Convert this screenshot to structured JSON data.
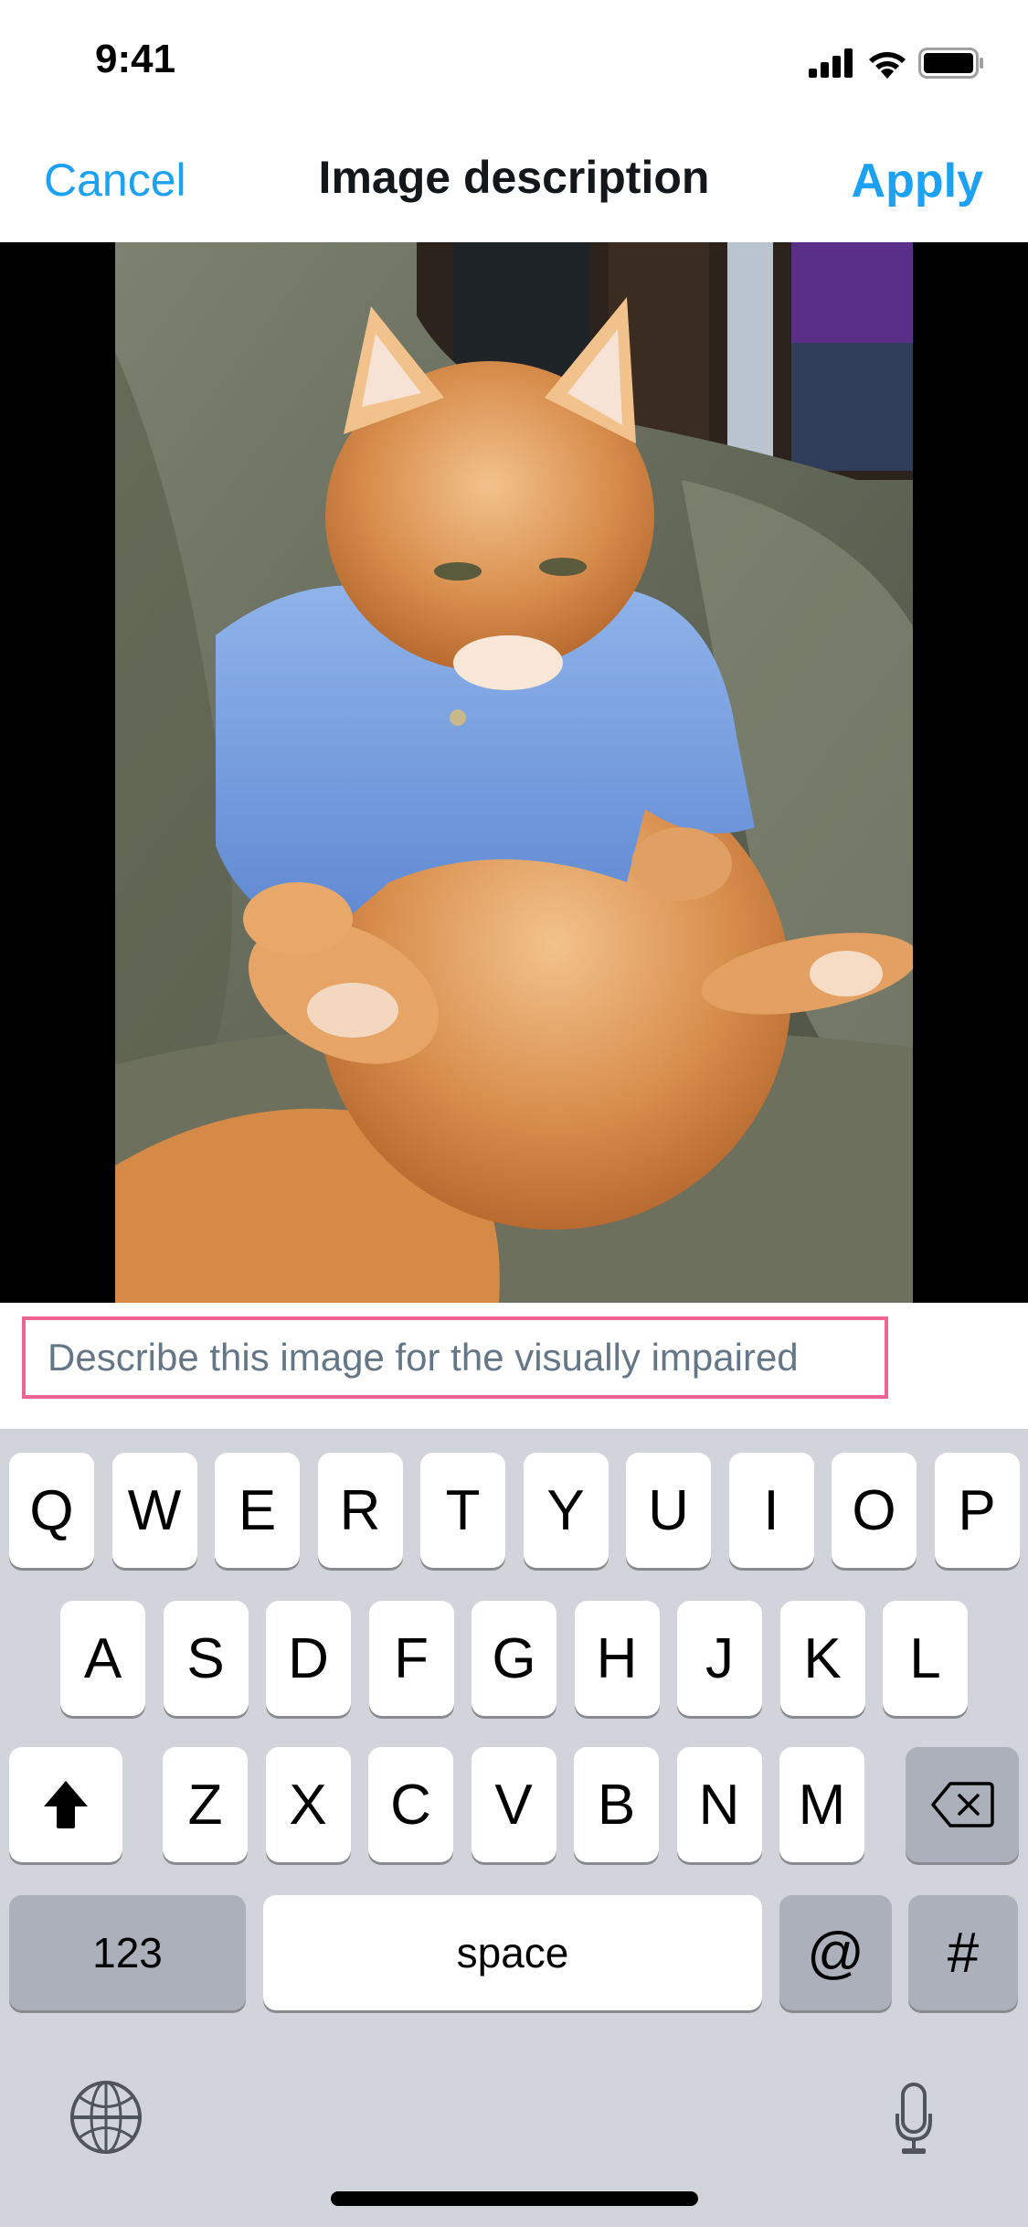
{
  "status_bar": {
    "time": "9:41",
    "icons": [
      "cellular-signal-icon",
      "wifi-icon",
      "battery-icon"
    ]
  },
  "nav": {
    "cancel_label": "Cancel",
    "title": "Image description",
    "apply_label": "Apply",
    "accent_color": "#1da1f2"
  },
  "media": {
    "subject": "Orange long-haired cat wearing a blue knitted cardigan sitting on a green couch"
  },
  "description": {
    "value": "",
    "placeholder": "Describe this image for the visually impaired",
    "focus_border_color": "#f06292"
  },
  "keyboard": {
    "row1": [
      "Q",
      "W",
      "E",
      "R",
      "T",
      "Y",
      "U",
      "I",
      "O",
      "P"
    ],
    "row2": [
      "A",
      "S",
      "D",
      "F",
      "G",
      "H",
      "J",
      "K",
      "L"
    ],
    "row3": [
      "Z",
      "X",
      "C",
      "V",
      "B",
      "N",
      "M"
    ],
    "shift_icon": "shift-arrow-icon",
    "delete_icon": "backspace-icon",
    "numbers_label": "123",
    "space_label": "space",
    "at_label": "@",
    "hash_label": "#",
    "globe_icon": "globe-icon",
    "mic_icon": "microphone-icon"
  }
}
